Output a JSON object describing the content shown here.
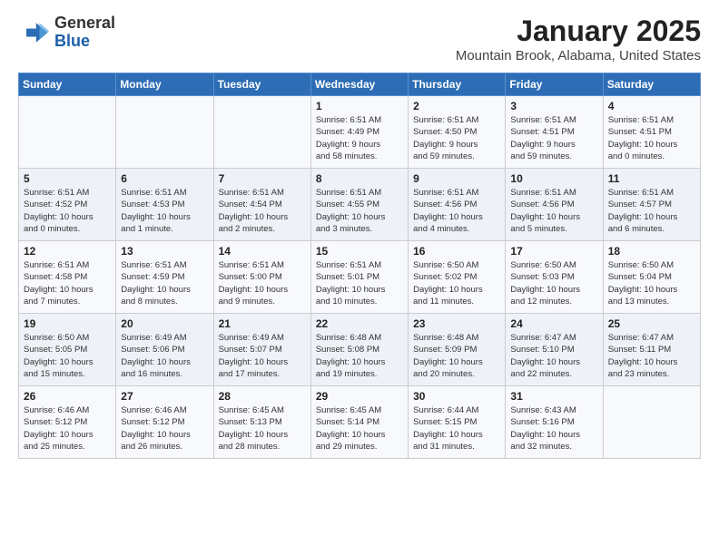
{
  "header": {
    "logo_general": "General",
    "logo_blue": "Blue",
    "title": "January 2025",
    "subtitle": "Mountain Brook, Alabama, United States"
  },
  "weekdays": [
    "Sunday",
    "Monday",
    "Tuesday",
    "Wednesday",
    "Thursday",
    "Friday",
    "Saturday"
  ],
  "weeks": [
    [
      {
        "day": "",
        "text": ""
      },
      {
        "day": "",
        "text": ""
      },
      {
        "day": "",
        "text": ""
      },
      {
        "day": "1",
        "text": "Sunrise: 6:51 AM\nSunset: 4:49 PM\nDaylight: 9 hours\nand 58 minutes."
      },
      {
        "day": "2",
        "text": "Sunrise: 6:51 AM\nSunset: 4:50 PM\nDaylight: 9 hours\nand 59 minutes."
      },
      {
        "day": "3",
        "text": "Sunrise: 6:51 AM\nSunset: 4:51 PM\nDaylight: 9 hours\nand 59 minutes."
      },
      {
        "day": "4",
        "text": "Sunrise: 6:51 AM\nSunset: 4:51 PM\nDaylight: 10 hours\nand 0 minutes."
      }
    ],
    [
      {
        "day": "5",
        "text": "Sunrise: 6:51 AM\nSunset: 4:52 PM\nDaylight: 10 hours\nand 0 minutes."
      },
      {
        "day": "6",
        "text": "Sunrise: 6:51 AM\nSunset: 4:53 PM\nDaylight: 10 hours\nand 1 minute."
      },
      {
        "day": "7",
        "text": "Sunrise: 6:51 AM\nSunset: 4:54 PM\nDaylight: 10 hours\nand 2 minutes."
      },
      {
        "day": "8",
        "text": "Sunrise: 6:51 AM\nSunset: 4:55 PM\nDaylight: 10 hours\nand 3 minutes."
      },
      {
        "day": "9",
        "text": "Sunrise: 6:51 AM\nSunset: 4:56 PM\nDaylight: 10 hours\nand 4 minutes."
      },
      {
        "day": "10",
        "text": "Sunrise: 6:51 AM\nSunset: 4:56 PM\nDaylight: 10 hours\nand 5 minutes."
      },
      {
        "day": "11",
        "text": "Sunrise: 6:51 AM\nSunset: 4:57 PM\nDaylight: 10 hours\nand 6 minutes."
      }
    ],
    [
      {
        "day": "12",
        "text": "Sunrise: 6:51 AM\nSunset: 4:58 PM\nDaylight: 10 hours\nand 7 minutes."
      },
      {
        "day": "13",
        "text": "Sunrise: 6:51 AM\nSunset: 4:59 PM\nDaylight: 10 hours\nand 8 minutes."
      },
      {
        "day": "14",
        "text": "Sunrise: 6:51 AM\nSunset: 5:00 PM\nDaylight: 10 hours\nand 9 minutes."
      },
      {
        "day": "15",
        "text": "Sunrise: 6:51 AM\nSunset: 5:01 PM\nDaylight: 10 hours\nand 10 minutes."
      },
      {
        "day": "16",
        "text": "Sunrise: 6:50 AM\nSunset: 5:02 PM\nDaylight: 10 hours\nand 11 minutes."
      },
      {
        "day": "17",
        "text": "Sunrise: 6:50 AM\nSunset: 5:03 PM\nDaylight: 10 hours\nand 12 minutes."
      },
      {
        "day": "18",
        "text": "Sunrise: 6:50 AM\nSunset: 5:04 PM\nDaylight: 10 hours\nand 13 minutes."
      }
    ],
    [
      {
        "day": "19",
        "text": "Sunrise: 6:50 AM\nSunset: 5:05 PM\nDaylight: 10 hours\nand 15 minutes."
      },
      {
        "day": "20",
        "text": "Sunrise: 6:49 AM\nSunset: 5:06 PM\nDaylight: 10 hours\nand 16 minutes."
      },
      {
        "day": "21",
        "text": "Sunrise: 6:49 AM\nSunset: 5:07 PM\nDaylight: 10 hours\nand 17 minutes."
      },
      {
        "day": "22",
        "text": "Sunrise: 6:48 AM\nSunset: 5:08 PM\nDaylight: 10 hours\nand 19 minutes."
      },
      {
        "day": "23",
        "text": "Sunrise: 6:48 AM\nSunset: 5:09 PM\nDaylight: 10 hours\nand 20 minutes."
      },
      {
        "day": "24",
        "text": "Sunrise: 6:47 AM\nSunset: 5:10 PM\nDaylight: 10 hours\nand 22 minutes."
      },
      {
        "day": "25",
        "text": "Sunrise: 6:47 AM\nSunset: 5:11 PM\nDaylight: 10 hours\nand 23 minutes."
      }
    ],
    [
      {
        "day": "26",
        "text": "Sunrise: 6:46 AM\nSunset: 5:12 PM\nDaylight: 10 hours\nand 25 minutes."
      },
      {
        "day": "27",
        "text": "Sunrise: 6:46 AM\nSunset: 5:12 PM\nDaylight: 10 hours\nand 26 minutes."
      },
      {
        "day": "28",
        "text": "Sunrise: 6:45 AM\nSunset: 5:13 PM\nDaylight: 10 hours\nand 28 minutes."
      },
      {
        "day": "29",
        "text": "Sunrise: 6:45 AM\nSunset: 5:14 PM\nDaylight: 10 hours\nand 29 minutes."
      },
      {
        "day": "30",
        "text": "Sunrise: 6:44 AM\nSunset: 5:15 PM\nDaylight: 10 hours\nand 31 minutes."
      },
      {
        "day": "31",
        "text": "Sunrise: 6:43 AM\nSunset: 5:16 PM\nDaylight: 10 hours\nand 32 minutes."
      },
      {
        "day": "",
        "text": ""
      }
    ]
  ]
}
